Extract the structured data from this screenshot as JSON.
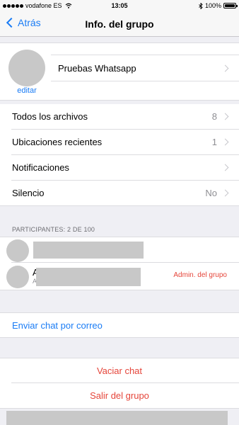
{
  "status_bar": {
    "carrier": "vodafone ES",
    "time": "13:05",
    "battery_percent": "100%",
    "battery_level": 1.0,
    "icons": [
      "wifi-icon",
      "bluetooth-icon",
      "battery-icon"
    ]
  },
  "nav": {
    "back_label": "Atrás",
    "title": "Info. del grupo"
  },
  "group": {
    "name": "Pruebas Whatsapp",
    "edit_label": "editar"
  },
  "settings": [
    {
      "label": "Todos los archivos",
      "value": "8"
    },
    {
      "label": "Ubicaciones recientes",
      "value": "1"
    },
    {
      "label": "Notificaciones",
      "value": ""
    },
    {
      "label": "Silencio",
      "value": "No"
    }
  ],
  "participants": {
    "header": "PARTICIPANTES: 2 DE 100",
    "items": [
      {
        "initial": "",
        "sub": "",
        "badge": ""
      },
      {
        "initial": "A",
        "sub": "A",
        "badge": "Admin. del grupo"
      }
    ]
  },
  "actions": {
    "email_chat": "Enviar chat por correo",
    "clear_chat": "Vaciar chat",
    "leave_group": "Salir del grupo"
  },
  "colors": {
    "accent": "#1a7cf5",
    "destructive": "#e5453a",
    "background": "#efeff4",
    "placeholder": "#c8c8c8"
  }
}
